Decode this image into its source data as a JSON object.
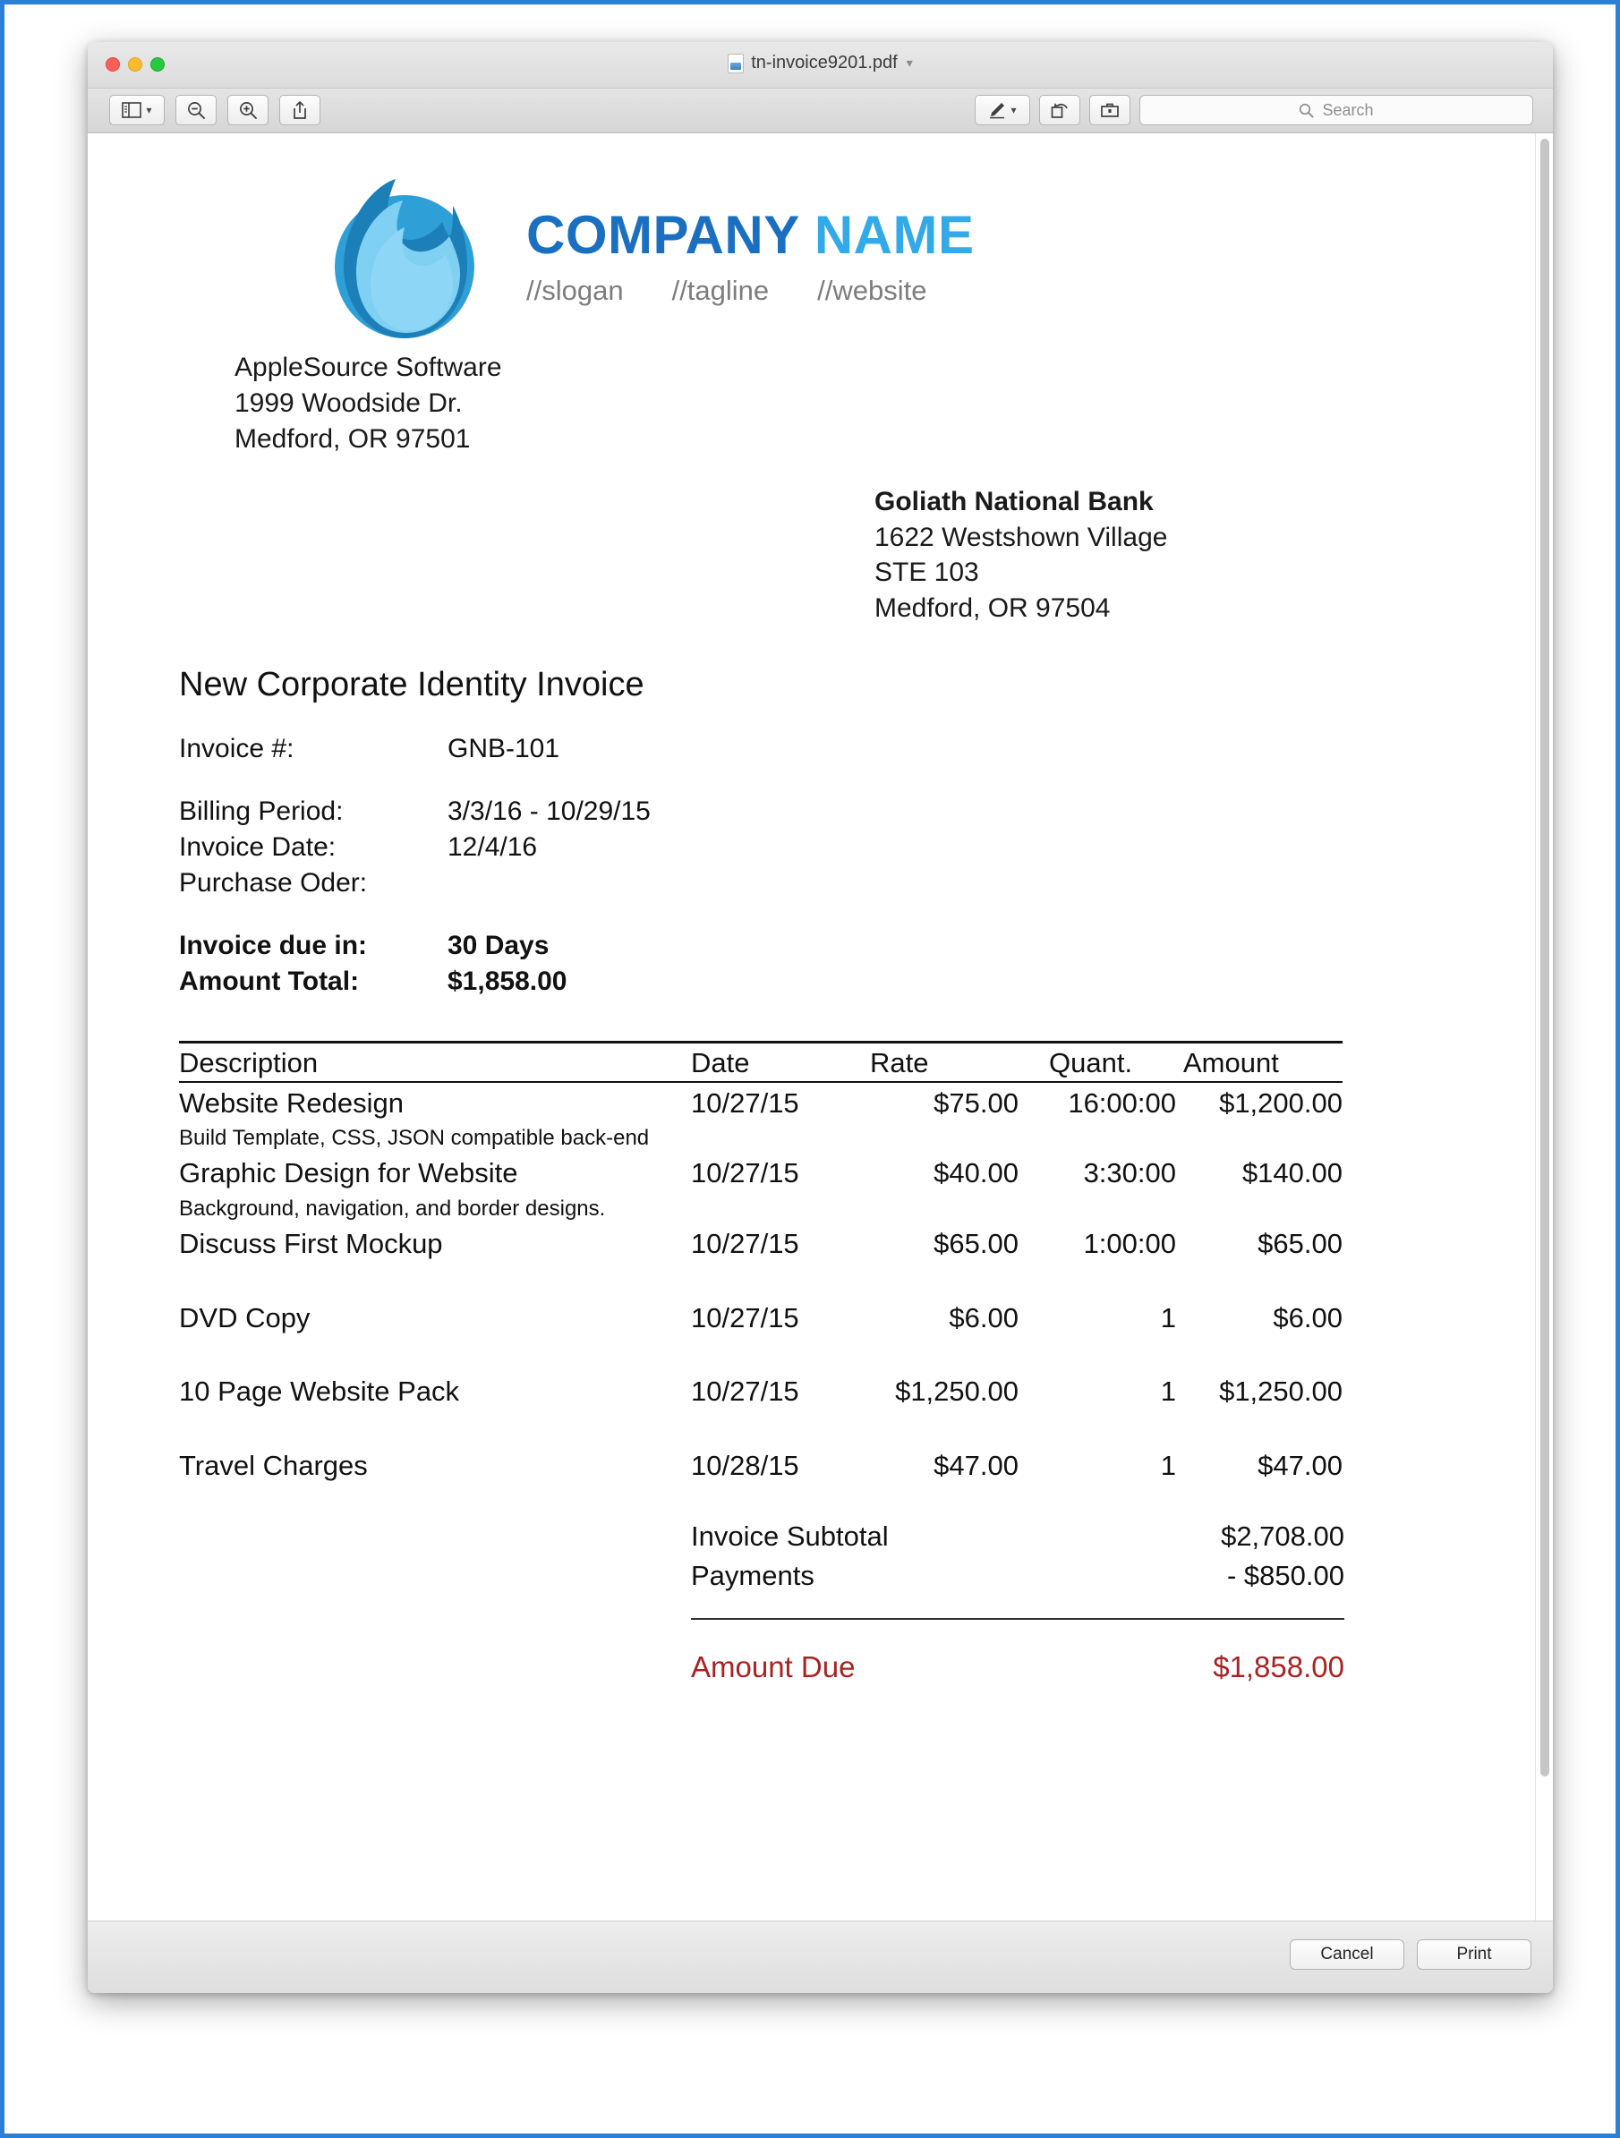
{
  "window": {
    "title": "tn-invoice9201.pdf",
    "title_chevron": "chevron-down-icon",
    "traffic_lights": [
      "close",
      "minimize",
      "zoom"
    ]
  },
  "toolbar": {
    "sidebar_button": "sidebar-toggle",
    "sidebar_chevron": "chevron-down-icon",
    "zoom_out_button": "zoom-out",
    "zoom_in_button": "zoom-in",
    "share_button": "share",
    "markup_button": "markup-pen",
    "markup_chevron": "chevron-down-icon",
    "rotate_button": "rotate-left",
    "toolbox_button": "show-markup-toolbar",
    "search_placeholder": "Search",
    "search_value": ""
  },
  "bottom_bar": {
    "cancel_label": "Cancel",
    "print_label": "Print"
  },
  "document": {
    "logo": {
      "company_word": "COMPANY",
      "name_word": "NAME",
      "slogan": "//slogan",
      "tagline": "//tagline",
      "website": "//website",
      "company_color": "#1a6fc0",
      "name_color": "#34a9e8"
    },
    "sender": {
      "line1": "AppleSource Software",
      "line2": "1999 Woodside Dr.",
      "line3": "Medford, OR 97501"
    },
    "recipient": {
      "line1": "Goliath National Bank",
      "line2": "1622 Westshown Village",
      "line3": "STE 103",
      "line4": "Medford, OR 97504"
    },
    "title": "New Corporate Identity Invoice",
    "fields": {
      "invoice_number_label": "Invoice #:",
      "invoice_number_value": "GNB-101",
      "billing_period_label": "Billing Period:",
      "billing_period_value": "3/3/16 - 10/29/15",
      "invoice_date_label": "Invoice Date:",
      "invoice_date_value": "12/4/16",
      "purchase_order_label": "Purchase Oder:",
      "purchase_order_value": "",
      "due_in_label": "Invoice due in:",
      "due_in_value": "30 Days",
      "amount_total_label": "Amount Total:",
      "amount_total_value": "$1,858.00"
    },
    "table": {
      "headers": {
        "description": "Description",
        "date": "Date",
        "rate": "Rate",
        "quantity": "Quant.",
        "amount": "Amount"
      },
      "rows": [
        {
          "description": "Website Redesign",
          "note": "Build Template, CSS, JSON compatible back-end",
          "date": "10/27/15",
          "rate": "$75.00",
          "quantity": "16:00:00",
          "amount": "$1,200.00"
        },
        {
          "description": "Graphic Design for Website",
          "note": "Background, navigation, and border designs.",
          "date": "10/27/15",
          "rate": "$40.00",
          "quantity": "3:30:00",
          "amount": "$140.00"
        },
        {
          "description": "Discuss First Mockup",
          "note": "",
          "date": "10/27/15",
          "rate": "$65.00",
          "quantity": "1:00:00",
          "amount": "$65.00"
        },
        {
          "description": "DVD Copy",
          "note": "",
          "date": "10/27/15",
          "rate": "$6.00",
          "quantity": "1",
          "amount": "$6.00"
        },
        {
          "description": "10 Page Website Pack",
          "note": "",
          "date": "10/27/15",
          "rate": "$1,250.00",
          "quantity": "1",
          "amount": "$1,250.00"
        },
        {
          "description": "Travel Charges",
          "note": "",
          "date": "10/28/15",
          "rate": "$47.00",
          "quantity": "1",
          "amount": "$47.00"
        }
      ]
    },
    "totals": {
      "subtotal_label": "Invoice Subtotal",
      "subtotal_value": "$2,708.00",
      "payments_label": "Payments",
      "payments_value": "- $850.00",
      "due_label": "Amount Due",
      "due_value": "$1,858.00",
      "due_color": "#a62423"
    }
  }
}
